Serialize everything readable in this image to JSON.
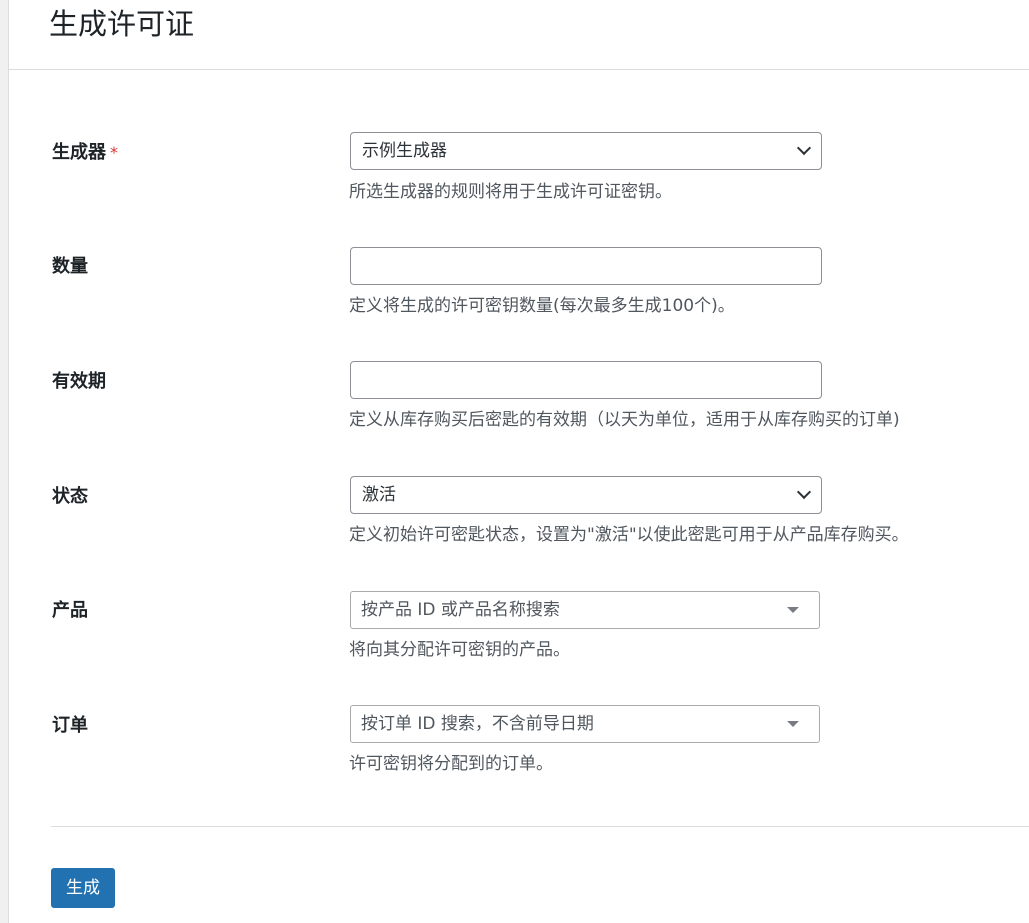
{
  "page": {
    "title": "生成许可证"
  },
  "form": {
    "generator": {
      "label": "生成器",
      "required_mark": "*",
      "value": "示例生成器",
      "icon": "chevron-down-icon",
      "description": "所选生成器的规则将用于生成许可证密钥。"
    },
    "quantity": {
      "label": "数量",
      "value": "",
      "description": "定义将生成的许可密钥数量(每次最多生成100个)。"
    },
    "validity": {
      "label": "有效期",
      "value": "",
      "description": "定义从库存购买后密匙的有效期（以天为单位，适用于从库存购买的订单)"
    },
    "status": {
      "label": "状态",
      "value": "激活",
      "icon": "chevron-down-icon",
      "description": "定义初始许可密匙状态，设置为\"激活\"以使此密匙可用于从产品库存购买。"
    },
    "product": {
      "label": "产品",
      "placeholder": "按产品 ID 或产品名称搜索",
      "icon": "caret-down-icon",
      "description": "将向其分配许可密钥的产品。"
    },
    "order": {
      "label": "订单",
      "placeholder": "按订单 ID 搜索，不含前导日期",
      "icon": "caret-down-icon",
      "description": "许可密钥将分配到的订单。"
    }
  },
  "actions": {
    "generate_label": "生成"
  },
  "colors": {
    "primary": "#2271b1",
    "required": "#d63638",
    "description_text": "#50575e",
    "border": "#8c8f94"
  }
}
